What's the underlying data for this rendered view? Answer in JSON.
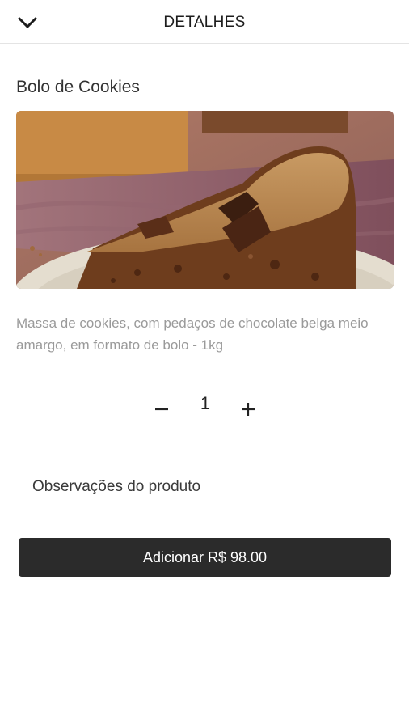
{
  "header": {
    "title": "DETALHES",
    "back_icon": "chevron-down-icon"
  },
  "product": {
    "name": "Bolo de Cookies",
    "description": "Massa de cookies, com pedaços de chocolate belga meio amargo, em formato de bolo - 1kg"
  },
  "quantity": {
    "value": "1",
    "minus_label": "−",
    "plus_label": "+"
  },
  "notes": {
    "placeholder": "Observações do produto",
    "value": ""
  },
  "add_button": {
    "label": "Adicionar R$ 98.00",
    "background": "#2b2b2b"
  }
}
